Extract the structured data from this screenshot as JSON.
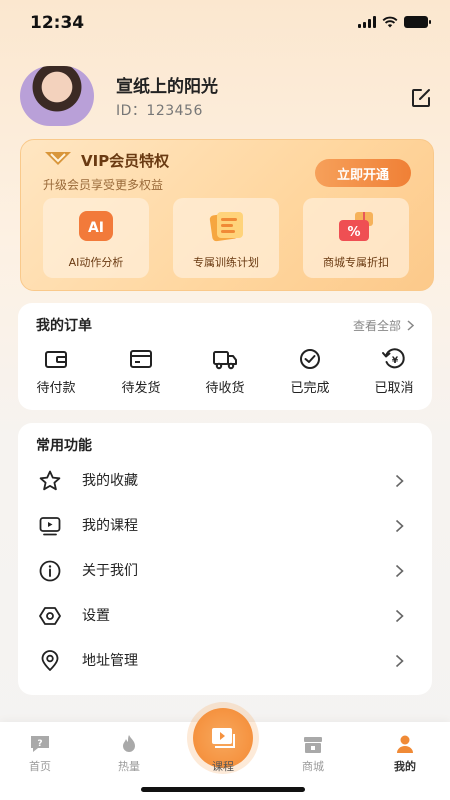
{
  "status_bar": {
    "time": "12:34"
  },
  "profile": {
    "username": "宣纸上的阳光",
    "user_id": "ID：123456"
  },
  "vip": {
    "title": "VIP会员特权",
    "subtitle": "升级会员享受更多权益",
    "cta": "立即开通",
    "benefits": [
      {
        "label": "AI动作分析",
        "icon": "ai-icon"
      },
      {
        "label": "专属训练计划",
        "icon": "plan-icon"
      },
      {
        "label": "商城专属折扣",
        "icon": "discount-icon"
      }
    ]
  },
  "orders": {
    "title": "我的订单",
    "view_all": "查看全部",
    "items": [
      {
        "label": "待付款",
        "icon": "wallet-icon"
      },
      {
        "label": "待发货",
        "icon": "card-icon"
      },
      {
        "label": "待收货",
        "icon": "truck-icon"
      },
      {
        "label": "已完成",
        "icon": "check-circle-icon"
      },
      {
        "label": "已取消",
        "icon": "refund-icon"
      }
    ]
  },
  "functions": {
    "title": "常用功能",
    "items": [
      {
        "label": "我的收藏",
        "icon": "star-icon"
      },
      {
        "label": "我的课程",
        "icon": "video-icon"
      },
      {
        "label": "关于我们",
        "icon": "info-icon"
      },
      {
        "label": "设置",
        "icon": "settings-icon"
      },
      {
        "label": "地址管理",
        "icon": "location-icon"
      }
    ]
  },
  "tabbar": {
    "tabs": [
      {
        "label": "首页",
        "icon": "home-icon"
      },
      {
        "label": "热量",
        "icon": "flame-icon"
      },
      {
        "label": "课程",
        "icon": "course-icon"
      },
      {
        "label": "商城",
        "icon": "shop-icon"
      },
      {
        "label": "我的",
        "icon": "user-icon"
      }
    ],
    "active": "我的"
  },
  "colors": {
    "accent": "#f5923f",
    "vip_text": "#6a3a12"
  }
}
